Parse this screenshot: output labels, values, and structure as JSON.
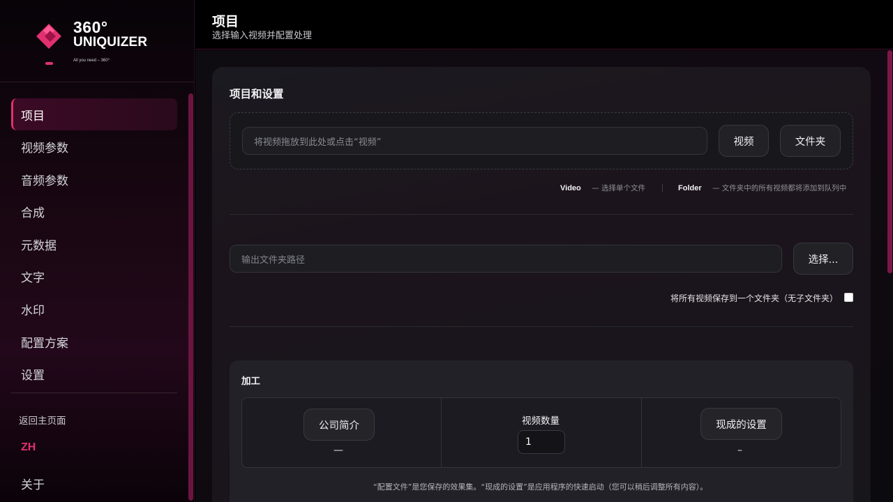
{
  "brand": {
    "line1": "360°",
    "line2": "UNIQUIZER",
    "tagline": "All you need – 360°",
    "accent": "#e0306e"
  },
  "sidebar": {
    "items": [
      {
        "label": "项目",
        "active": true
      },
      {
        "label": "视频参数"
      },
      {
        "label": "音频参数"
      },
      {
        "label": "合成"
      },
      {
        "label": "元数据"
      },
      {
        "label": "文字"
      },
      {
        "label": "水印"
      },
      {
        "label": "配置方案"
      },
      {
        "label": "设置"
      }
    ],
    "back_home": "返回主页面",
    "language": "ZH",
    "about": "关于"
  },
  "header": {
    "title": "项目",
    "subtitle": "选择输入视频并配置处理"
  },
  "project": {
    "section_title": "项目和设置",
    "drop_placeholder": "将视频拖放到此处或点击“视频”",
    "video_button": "视频",
    "folder_button": "文件夹",
    "hint_video_key": "Video",
    "hint_video_text": "— 选择单个文件",
    "hint_folder_key": "Folder",
    "hint_folder_text": "— 文件夹中的所有视频都将添加到队列中",
    "output_placeholder": "输出文件夹路径",
    "choose_button": "选择...",
    "save_all_label": "将所有视频保存到一个文件夹（无子文件夹）",
    "save_all_checked": false
  },
  "processing": {
    "title": "加工",
    "profile_button": "公司简介",
    "profile_value": "—",
    "count_label": "视频数量",
    "count_value": "1",
    "preset_button": "现成的设置",
    "preset_value": "–",
    "footnote": "“配置文件”是您保存的效果集。“现成的设置”是应用程序的快速启动（您可以稍后调整所有内容）。"
  }
}
